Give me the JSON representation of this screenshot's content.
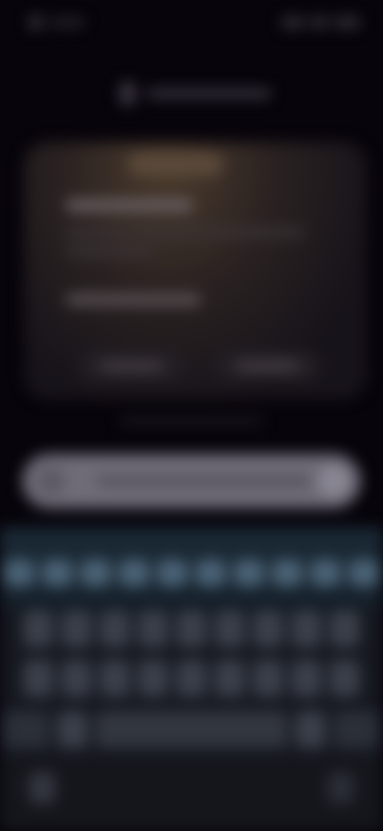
{
  "status_bar": {},
  "header": {},
  "card": {},
  "composer": {},
  "keyboard": {
    "rows": [
      10,
      9,
      9,
      5
    ]
  },
  "colors": {
    "background": "#07040b",
    "card_glow": "#4a3a2c",
    "input_bar": "#6f6c78",
    "keyboard": "#161820",
    "number_keys": "#4a6275"
  }
}
